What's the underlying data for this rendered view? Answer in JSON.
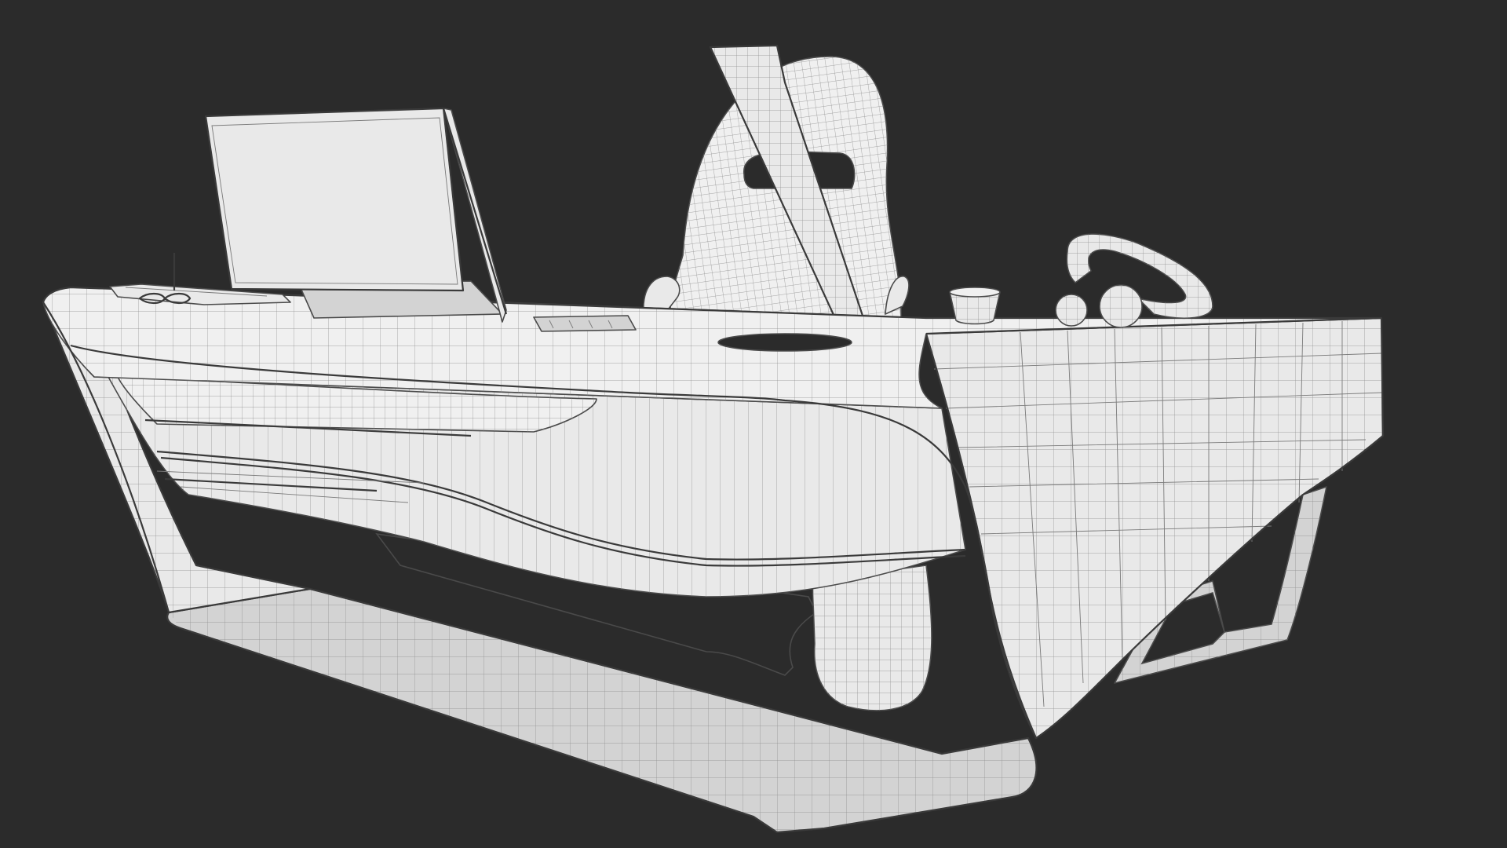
{
  "scene": {
    "background_color": "#2b2b2b",
    "model_surface_color": "#e9e9e9",
    "wire_color": "#7a7a7a",
    "render_style": "clay wireframe render",
    "objects": [
      "desk-body",
      "monitor",
      "office-chair",
      "cup",
      "desk-sculpture",
      "tablet-with-pen",
      "eyeglasses"
    ]
  }
}
